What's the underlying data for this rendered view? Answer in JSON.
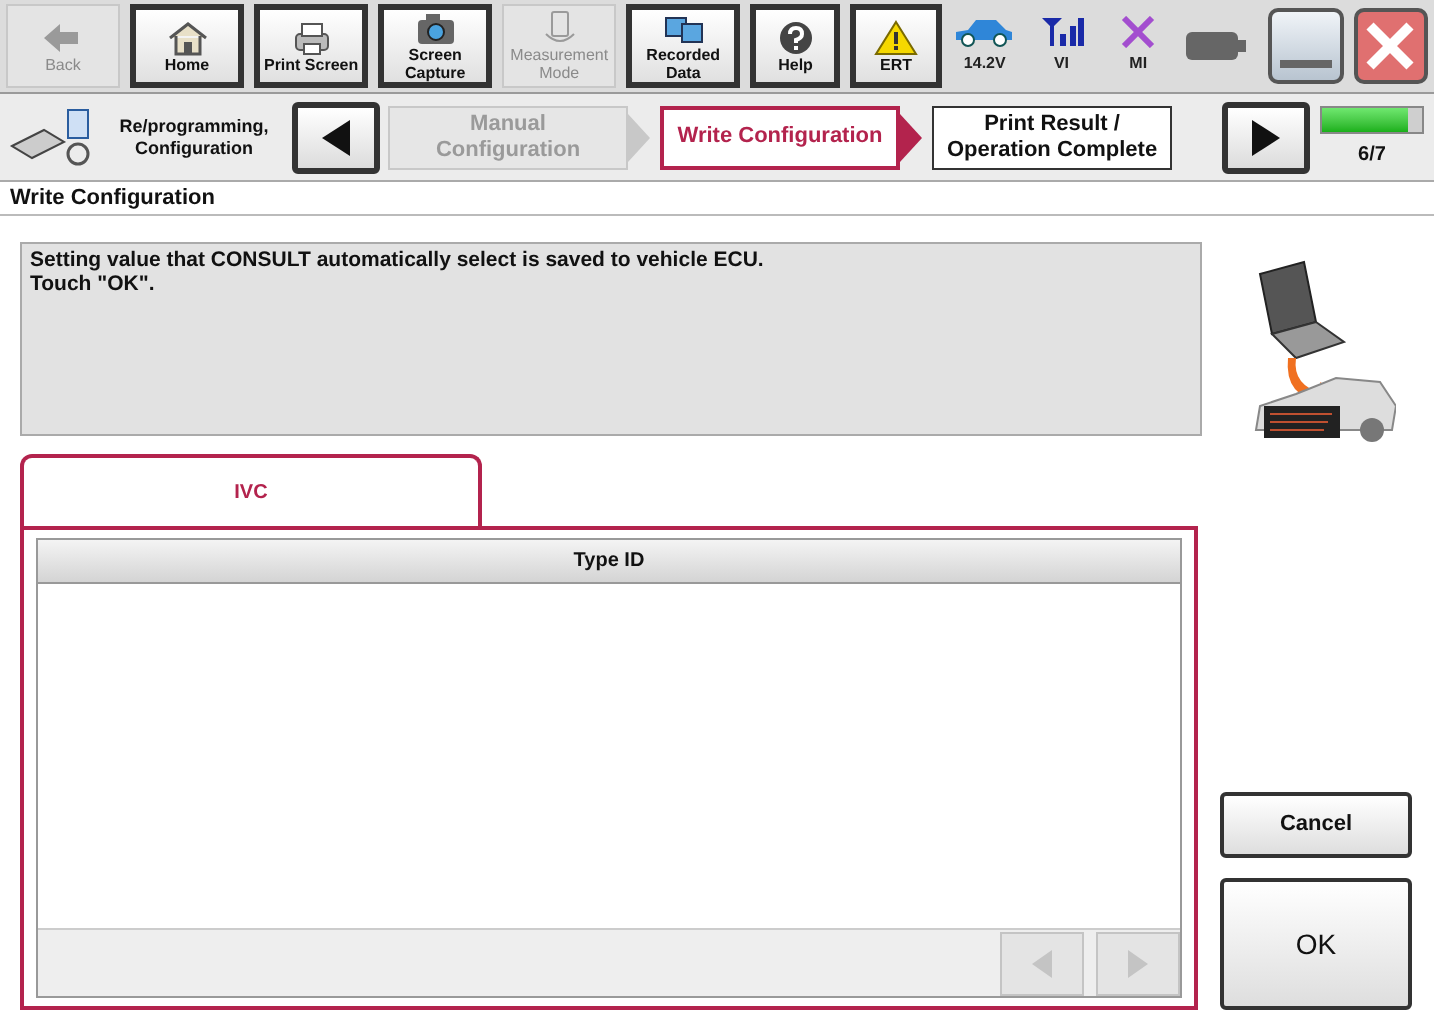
{
  "toolbar": {
    "buttons": [
      {
        "kind": "back",
        "label": "Back",
        "disabled": true
      },
      {
        "kind": "home",
        "label": "Home",
        "disabled": false
      },
      {
        "kind": "print",
        "label": "Print Screen",
        "disabled": false
      },
      {
        "kind": "camera",
        "label": "Screen Capture",
        "disabled": false
      },
      {
        "kind": "measure",
        "label": "Measurement Mode",
        "disabled": true
      },
      {
        "kind": "data",
        "label": "Recorded Data",
        "disabled": false
      },
      {
        "kind": "help",
        "label": "Help",
        "disabled": false
      },
      {
        "kind": "ert",
        "label": "ERT",
        "disabled": false
      }
    ],
    "status": [
      {
        "kind": "car",
        "label": "14.2V"
      },
      {
        "kind": "signal",
        "label": "VI"
      },
      {
        "kind": "cross",
        "label": "MI"
      },
      {
        "kind": "battery"
      }
    ]
  },
  "steps": {
    "mode": "Re/programming, Configuration",
    "items": [
      {
        "label": "Manual Configuration",
        "selected": false,
        "done": true
      },
      {
        "label": "Write Configuration",
        "selected": true,
        "done": false
      },
      {
        "label": "Print Result / Operation Complete",
        "selected": false,
        "done": false
      }
    ],
    "progress": {
      "level": 0.86,
      "reading": "6/7"
    }
  },
  "page_title": "Write Configuration",
  "message": [
    "Setting value that CONSULT automatically select is saved to vehicle ECU.",
    "Touch \"OK\"."
  ],
  "tabs": [
    {
      "label": "IVC",
      "selected": true
    }
  ],
  "table": {
    "columns": [
      "Type ID"
    ]
  },
  "buttons": [
    "Cancel",
    "OK"
  ]
}
